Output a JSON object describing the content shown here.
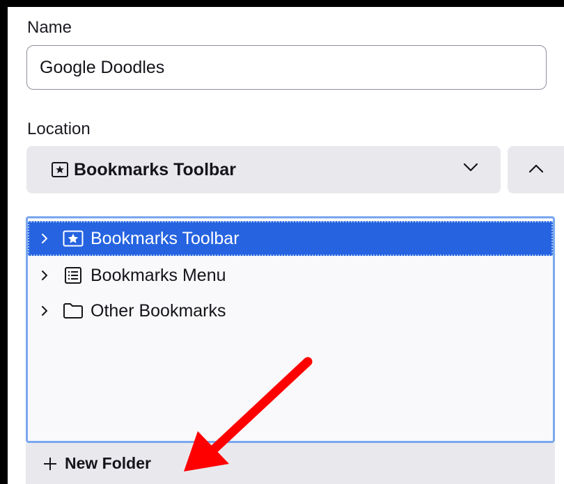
{
  "name_field": {
    "label": "Name",
    "value": "Google Doodles"
  },
  "location": {
    "label": "Location",
    "selected": "Bookmarks Toolbar",
    "selected_icon": "star-folder-icon",
    "dropdown_icon": "chevron-down-icon",
    "collapse_icon": "chevron-up-icon"
  },
  "folder_tree": {
    "items": [
      {
        "label": "Bookmarks Toolbar",
        "icon": "star-folder-icon",
        "selected": true
      },
      {
        "label": "Bookmarks Menu",
        "icon": "menu-list-icon",
        "selected": false
      },
      {
        "label": "Other Bookmarks",
        "icon": "folder-icon",
        "selected": false
      }
    ]
  },
  "actions": {
    "new_folder_label": "New Folder",
    "new_folder_icon": "plus-icon"
  },
  "annotation": {
    "arrow_color": "#ff0000"
  },
  "colors": {
    "selection": "#2563e0",
    "focus_border": "#7aa7ef",
    "button_bg": "#e9e9ed"
  }
}
